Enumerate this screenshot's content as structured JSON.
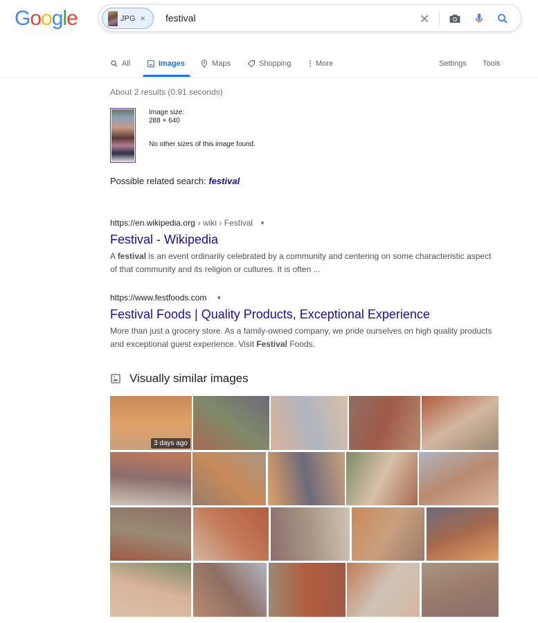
{
  "logo": {
    "text": [
      "G",
      "o",
      "o",
      "g",
      "l",
      "e"
    ],
    "colors": [
      "#4285F4",
      "#EA4335",
      "#FBBC05",
      "#4285F4",
      "#34A853",
      "#EA4335"
    ]
  },
  "search": {
    "chip_label": "JPG",
    "chip_close": "×",
    "query": "festival",
    "icons": [
      "clear-icon",
      "camera-icon",
      "mic-icon",
      "search-icon"
    ]
  },
  "tabs": [
    {
      "label": "All",
      "icon": "search-icon"
    },
    {
      "label": "Images",
      "icon": "image-icon"
    },
    {
      "label": "Maps",
      "icon": "map-pin-icon"
    },
    {
      "label": "Shopping",
      "icon": "tag-icon"
    },
    {
      "label": "More",
      "icon": "more-vert-icon"
    },
    {
      "label": "Settings"
    },
    {
      "label": "Tools"
    }
  ],
  "stats": "About 2 results (0.91 seconds)",
  "image_info": {
    "size_label": "Image size:",
    "size_value": "288 × 640",
    "no_other": "No other sizes of this image found."
  },
  "related": {
    "prefix": "Possible related search:",
    "term": "festival"
  },
  "results": [
    {
      "url": "https://en.wikipedia.org",
      "breadcrumb": " › wiki › Festival",
      "title": "Festival - Wikipedia",
      "snippet_pre": "A ",
      "snippet_bold": "festival",
      "snippet_post": " is an event ordinarily celebrated by a community and centering on some characteristic aspect of that community and its religion or cultures. It is often ..."
    },
    {
      "url": "https://www.festfoods.com",
      "breadcrumb": "",
      "title": "Festival Foods | Quality Products, Exceptional Experience",
      "snippet_pre": "More than just a grocery store. As a family-owned company, we pride ourselves on high quality products and exceptional guest experience. Visit ",
      "snippet_bold": "Festival",
      "snippet_post": " Foods."
    }
  ],
  "visually_similar": {
    "heading": "Visually similar images",
    "badge": "3 days ago",
    "palette": [
      "#c9a07e",
      "#a86a4e",
      "#d9b39a",
      "#8f6f64",
      "#b25d3e",
      "#cfc3b6",
      "#9a7b6a",
      "#e0a066",
      "#7f8a6a",
      "#b0b4c0",
      "#a05a48",
      "#d4b6a0",
      "#8c6e6e",
      "#c98a5a",
      "#6e6a7a",
      "#d8c0a8",
      "#b88a70",
      "#9a8a74",
      "#c47a5a",
      "#a89684"
    ]
  }
}
